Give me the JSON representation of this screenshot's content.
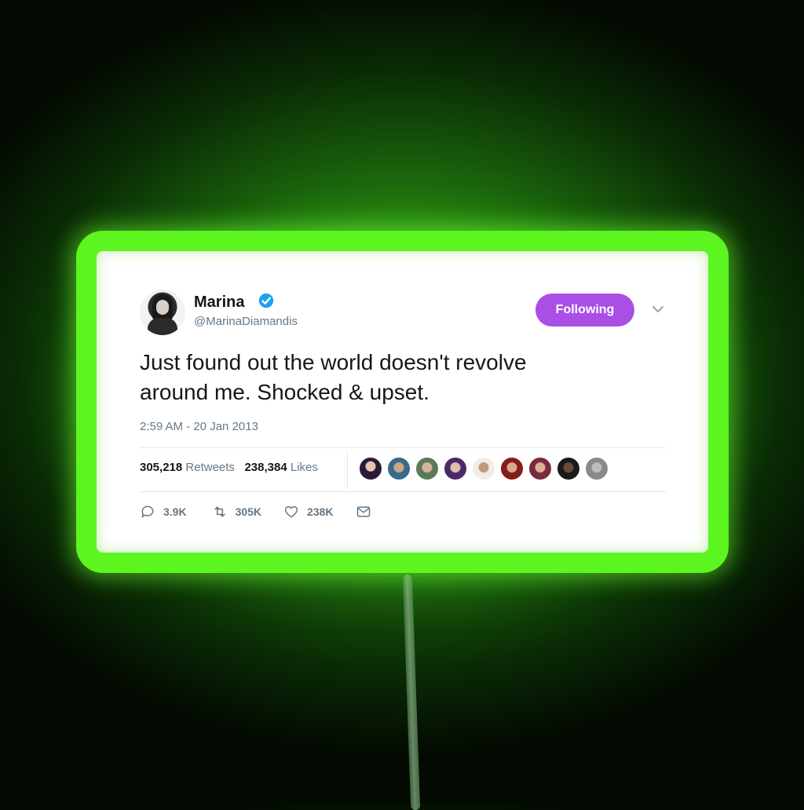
{
  "tweet": {
    "author_name": "Marina",
    "handle": "@MarinaDiamandis",
    "follow_label": "Following",
    "text_line1": "Just found out the world doesn't revolve",
    "text_line2": "around me. Shocked & upset.",
    "timestamp": "2:59 AM - 20 Jan 2013",
    "retweets_count": "305,218",
    "retweets_label": "Retweets",
    "likes_count": "238,384",
    "likes_label": "Likes",
    "replies_short": "3.9K",
    "retweets_short": "305K",
    "likes_short": "238K"
  },
  "colors": {
    "accent_button": "#a94fe6",
    "neon_frame": "#5df51f",
    "verified_badge": "#1da1f2",
    "muted_text": "#657786"
  },
  "icons": [
    "verified-badge-icon",
    "chevron-down-icon",
    "reply-icon",
    "retweet-icon",
    "heart-icon",
    "mail-icon"
  ]
}
